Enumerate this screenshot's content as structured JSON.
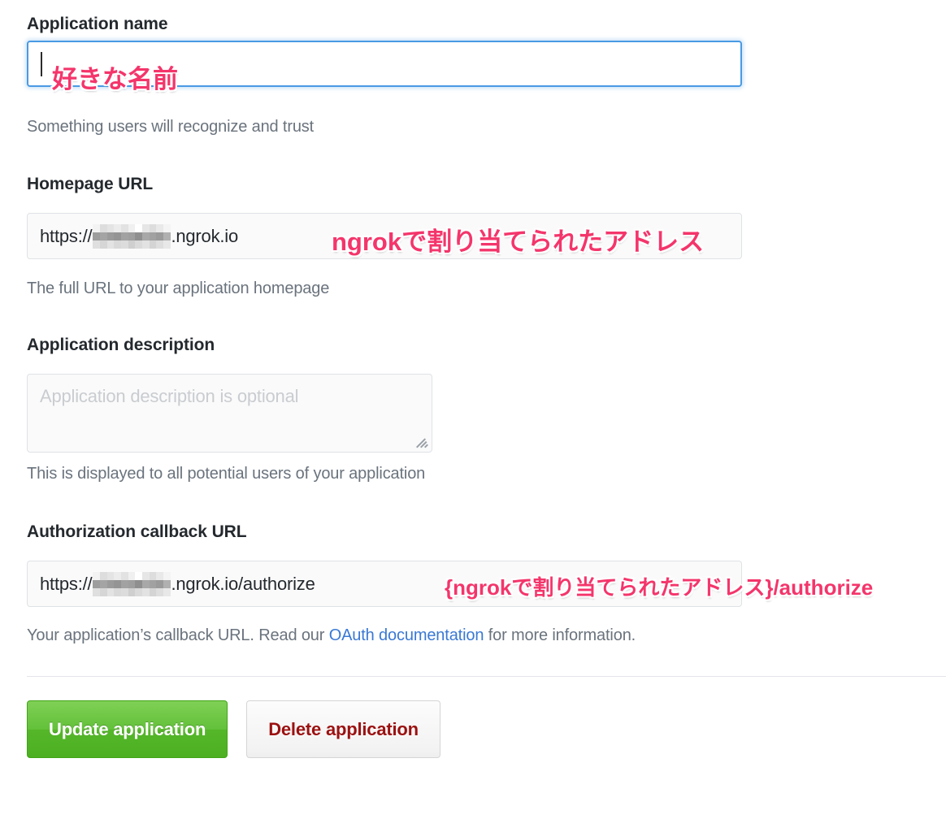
{
  "form": {
    "fields": [
      {
        "label": "Application name",
        "value": "",
        "hint": "Something users will recognize and trust",
        "focused": true,
        "annotation": "好きな名前"
      },
      {
        "label": "Homepage URL",
        "value_prefix": "https://",
        "value_redacted": true,
        "value_suffix": ".ngrok.io",
        "hint": "The full URL to your application homepage",
        "focused": false,
        "annotation": "ngrokで割り当てられたアドレス"
      },
      {
        "label": "Application description",
        "placeholder": "Application description is optional",
        "hint": "This is displayed to all potential users of your application",
        "focused": false,
        "annotation": ""
      },
      {
        "label": "Authorization callback URL",
        "value_prefix": "https://",
        "value_redacted": true,
        "value_suffix": ".ngrok.io/authorize",
        "hint_before_link": "Your application’s callback URL. Read our ",
        "hint_link": "OAuth documentation",
        "hint_after_link": " for more information.",
        "focused": false,
        "annotation": "{ngrokで割り当てられたアドレス}/authorize"
      }
    ],
    "buttons": {
      "update_label": "Update application",
      "delete_label": "Delete application"
    }
  },
  "colors": {
    "annotation_pink": "#f4356b",
    "link_blue": "#3a79d4",
    "primary_green": "#55b62a",
    "danger_red": "#9b1111",
    "label_dark": "#24292e",
    "hint_gray": "#6a737d"
  }
}
